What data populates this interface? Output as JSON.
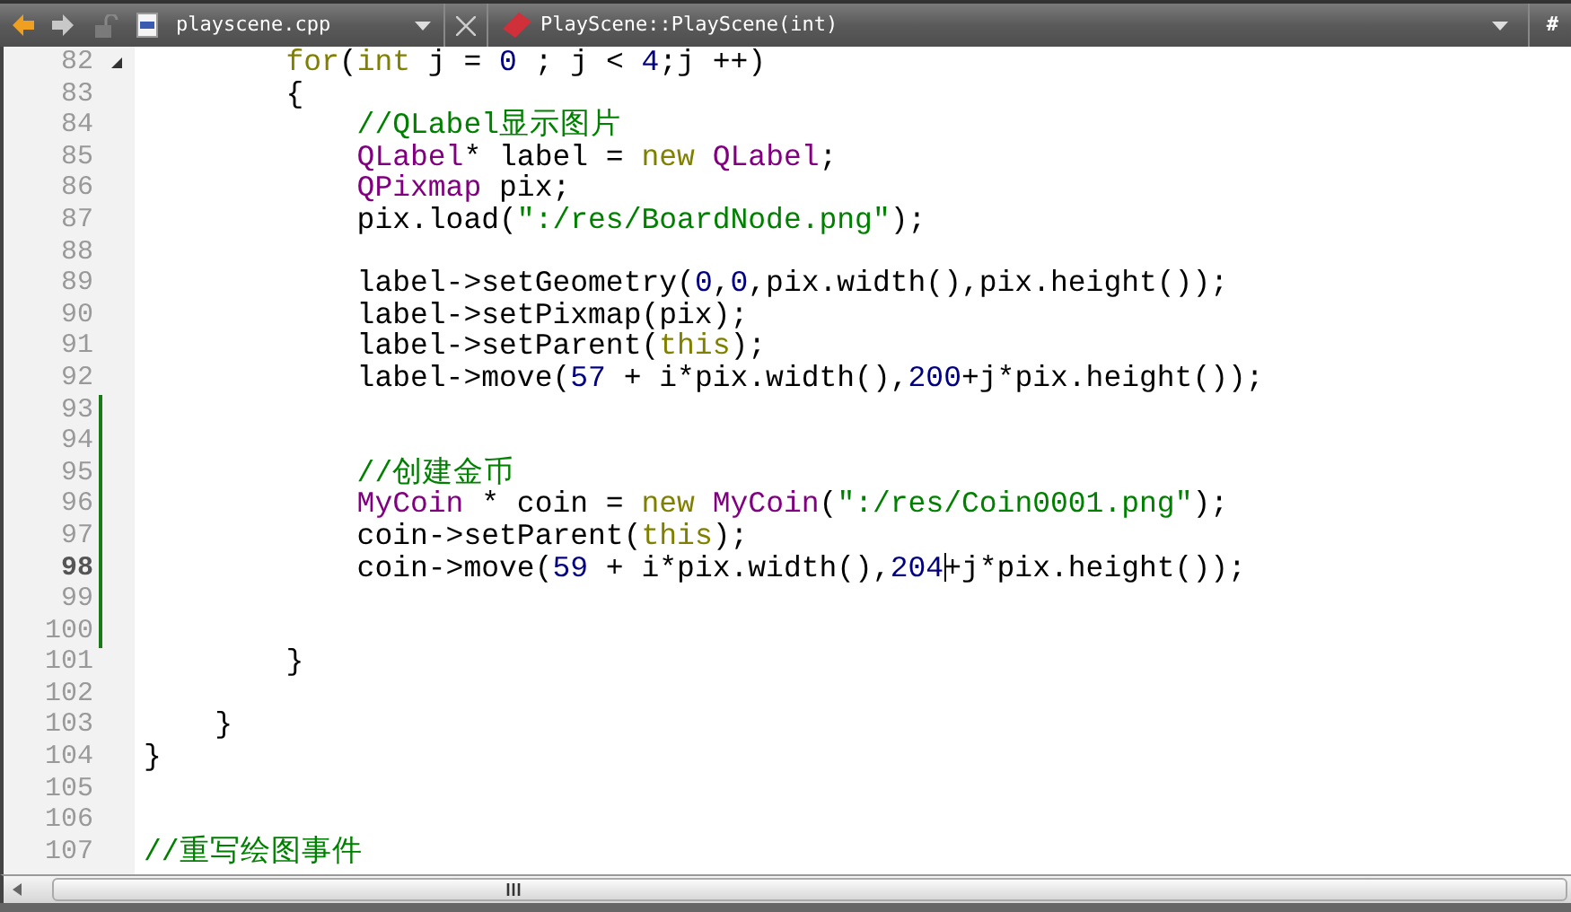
{
  "toolbar": {
    "file_name": "playscene.cpp",
    "function_name": "PlayScene::PlayScene(int)",
    "hash_button": "#"
  },
  "lines": [
    {
      "number": "82",
      "kind": "loop",
      "fold": true,
      "changed": false,
      "current": false,
      "tokens": [
        {
          "kind": "keyword",
          "text": "for"
        },
        {
          "kind": "plain",
          "text": "("
        },
        {
          "kind": "keyword",
          "text": "int"
        },
        {
          "kind": "plain",
          "text": " j = "
        },
        {
          "kind": "number",
          "text": "0"
        },
        {
          "kind": "plain",
          "text": " ; j < "
        },
        {
          "kind": "number",
          "text": "4"
        },
        {
          "kind": "plain",
          "text": ";j ++)"
        }
      ]
    },
    {
      "number": "83",
      "kind": "loop",
      "fold": false,
      "changed": false,
      "current": false,
      "tokens": [
        {
          "kind": "plain",
          "text": "{"
        }
      ]
    },
    {
      "number": "84",
      "kind": "inner",
      "fold": false,
      "changed": false,
      "current": false,
      "tokens": [
        {
          "kind": "comment",
          "text": "//QLabel显示图片"
        }
      ]
    },
    {
      "number": "85",
      "kind": "inner",
      "fold": false,
      "changed": false,
      "current": false,
      "tokens": [
        {
          "kind": "type",
          "text": "QLabel"
        },
        {
          "kind": "plain",
          "text": "* label = "
        },
        {
          "kind": "keyword",
          "text": "new"
        },
        {
          "kind": "type",
          "text": " QLabel"
        },
        {
          "kind": "plain",
          "text": ";"
        }
      ]
    },
    {
      "number": "86",
      "kind": "inner",
      "fold": false,
      "changed": false,
      "current": false,
      "tokens": [
        {
          "kind": "type",
          "text": "QPixmap"
        },
        {
          "kind": "plain",
          "text": " pix;"
        }
      ]
    },
    {
      "number": "87",
      "kind": "inner",
      "fold": false,
      "changed": false,
      "current": false,
      "tokens": [
        {
          "kind": "plain",
          "text": "pix.load("
        },
        {
          "kind": "string",
          "text": "\":/res/BoardNode.png\""
        },
        {
          "kind": "plain",
          "text": ");"
        }
      ]
    },
    {
      "number": "88",
      "kind": "blank",
      "fold": false,
      "changed": false,
      "current": false
    },
    {
      "number": "89",
      "kind": "inner",
      "fold": false,
      "changed": false,
      "current": false,
      "tokens": [
        {
          "kind": "plain",
          "text": "label->setGeometry("
        },
        {
          "kind": "number",
          "text": "0"
        },
        {
          "kind": "plain",
          "text": ","
        },
        {
          "kind": "number",
          "text": "0"
        },
        {
          "kind": "plain",
          "text": ",pix.width(),pix.height());"
        }
      ]
    },
    {
      "number": "90",
      "kind": "inner",
      "fold": false,
      "changed": false,
      "current": false,
      "tokens": [
        {
          "kind": "plain",
          "text": "label->setPixmap(pix);"
        }
      ]
    },
    {
      "number": "91",
      "kind": "inner",
      "fold": false,
      "changed": false,
      "current": false,
      "tokens": [
        {
          "kind": "plain",
          "text": "label->setParent("
        },
        {
          "kind": "keyword",
          "text": "this"
        },
        {
          "kind": "plain",
          "text": ");"
        }
      ]
    },
    {
      "number": "92",
      "kind": "inner",
      "fold": false,
      "changed": false,
      "current": false,
      "tokens": [
        {
          "kind": "plain",
          "text": "label->move("
        },
        {
          "kind": "number",
          "text": "57"
        },
        {
          "kind": "plain",
          "text": " + i*pix.width(),"
        },
        {
          "kind": "number",
          "text": "200"
        },
        {
          "kind": "plain",
          "text": "+j*pix.height());"
        }
      ]
    },
    {
      "number": "93",
      "kind": "blank",
      "fold": false,
      "changed": true,
      "current": false
    },
    {
      "number": "94",
      "kind": "blank",
      "fold": false,
      "changed": true,
      "current": false
    },
    {
      "number": "95",
      "kind": "inner",
      "fold": false,
      "changed": true,
      "current": false,
      "tokens": [
        {
          "kind": "comment",
          "text": "//创建金币"
        }
      ]
    },
    {
      "number": "96",
      "kind": "inner",
      "fold": false,
      "changed": true,
      "current": false,
      "tokens": [
        {
          "kind": "type",
          "text": "MyCoin"
        },
        {
          "kind": "plain",
          "text": " * coin = "
        },
        {
          "kind": "keyword",
          "text": "new"
        },
        {
          "kind": "type",
          "text": " MyCoin"
        },
        {
          "kind": "plain",
          "text": "("
        },
        {
          "kind": "string",
          "text": "\":/res/Coin0001.png\""
        },
        {
          "kind": "plain",
          "text": ");"
        }
      ]
    },
    {
      "number": "97",
      "kind": "inner",
      "fold": false,
      "changed": true,
      "current": false,
      "tokens": [
        {
          "kind": "plain",
          "text": "coin->setParent("
        },
        {
          "kind": "keyword",
          "text": "this"
        },
        {
          "kind": "plain",
          "text": ");"
        }
      ]
    },
    {
      "number": "98",
      "kind": "inner",
      "fold": false,
      "changed": true,
      "current": true,
      "tokens": [
        {
          "kind": "plain",
          "text": "coin->move("
        },
        {
          "kind": "number",
          "text": "59"
        },
        {
          "kind": "plain",
          "text": " + i*pix.width(),"
        },
        {
          "kind": "number",
          "text": "204",
          "cursor_after": true
        },
        {
          "kind": "plain",
          "text": "+j*pix.height());"
        }
      ]
    },
    {
      "number": "99",
      "kind": "blank",
      "fold": false,
      "changed": true,
      "current": false
    },
    {
      "number": "100",
      "kind": "blank",
      "fold": false,
      "changed": true,
      "current": false
    },
    {
      "number": "101",
      "kind": "loop",
      "fold": false,
      "changed": false,
      "current": false,
      "tokens": [
        {
          "kind": "plain",
          "text": "}"
        }
      ]
    },
    {
      "number": "102",
      "kind": "blank",
      "fold": false,
      "changed": false,
      "current": false
    },
    {
      "number": "103",
      "kind": "body",
      "fold": false,
      "changed": false,
      "current": false,
      "tokens": [
        {
          "kind": "plain",
          "text": "}"
        }
      ]
    },
    {
      "number": "104",
      "kind": "outer",
      "fold": false,
      "changed": false,
      "current": false,
      "tokens": [
        {
          "kind": "plain",
          "text": "}"
        }
      ]
    },
    {
      "number": "105",
      "kind": "blank",
      "fold": false,
      "changed": false,
      "current": false
    },
    {
      "number": "106",
      "kind": "blank",
      "fold": false,
      "changed": false,
      "current": false
    },
    {
      "number": "107",
      "kind": "outer",
      "fold": false,
      "changed": false,
      "current": false,
      "tokens": [
        {
          "kind": "comment",
          "text": "//重写绘图事件"
        }
      ]
    }
  ]
}
